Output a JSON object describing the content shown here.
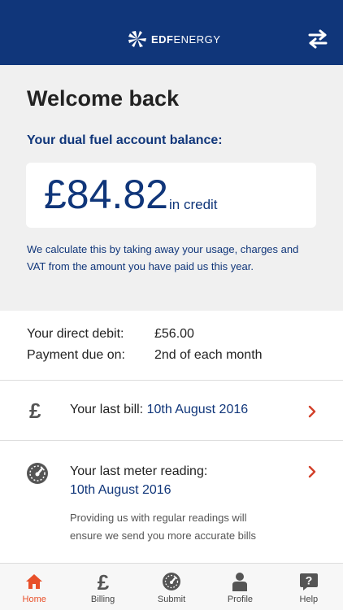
{
  "header": {
    "logo_brand": "EDF",
    "logo_suffix": "ENERGY",
    "swap_icon": "swap-arrows-icon"
  },
  "welcome": {
    "title": "Welcome back",
    "balance_label": "Your dual fuel account balance:",
    "balance_amount": "£84.82",
    "balance_suffix": "in credit",
    "balance_note": "We calculate this by taking away your usage, charges and VAT from the amount you have paid us this year."
  },
  "direct_debit": {
    "amount_label": "Your direct debit:",
    "amount_value": "£56.00",
    "due_label": "Payment due on:",
    "due_value": "2nd of each month"
  },
  "last_bill": {
    "icon": "pound-icon",
    "label": "Your last bill:",
    "date": "10th August 2016"
  },
  "meter": {
    "icon": "gauge-icon",
    "title": "Your last meter reading:",
    "date": "10th August 2016",
    "note": "Providing us with regular readings will ensure we send you more accurate bills"
  },
  "tabs": [
    {
      "label": "Home",
      "icon": "home-icon",
      "active": true
    },
    {
      "label": "Billing",
      "icon": "pound-icon",
      "active": false
    },
    {
      "label": "Submit",
      "icon": "gauge-icon",
      "active": false
    },
    {
      "label": "Profile",
      "icon": "person-icon",
      "active": false
    },
    {
      "label": "Help",
      "icon": "help-icon",
      "active": false
    }
  ],
  "colors": {
    "brand_navy": "#10367a",
    "accent_orange": "#e8502a",
    "panel_grey": "#f0f0f0"
  }
}
